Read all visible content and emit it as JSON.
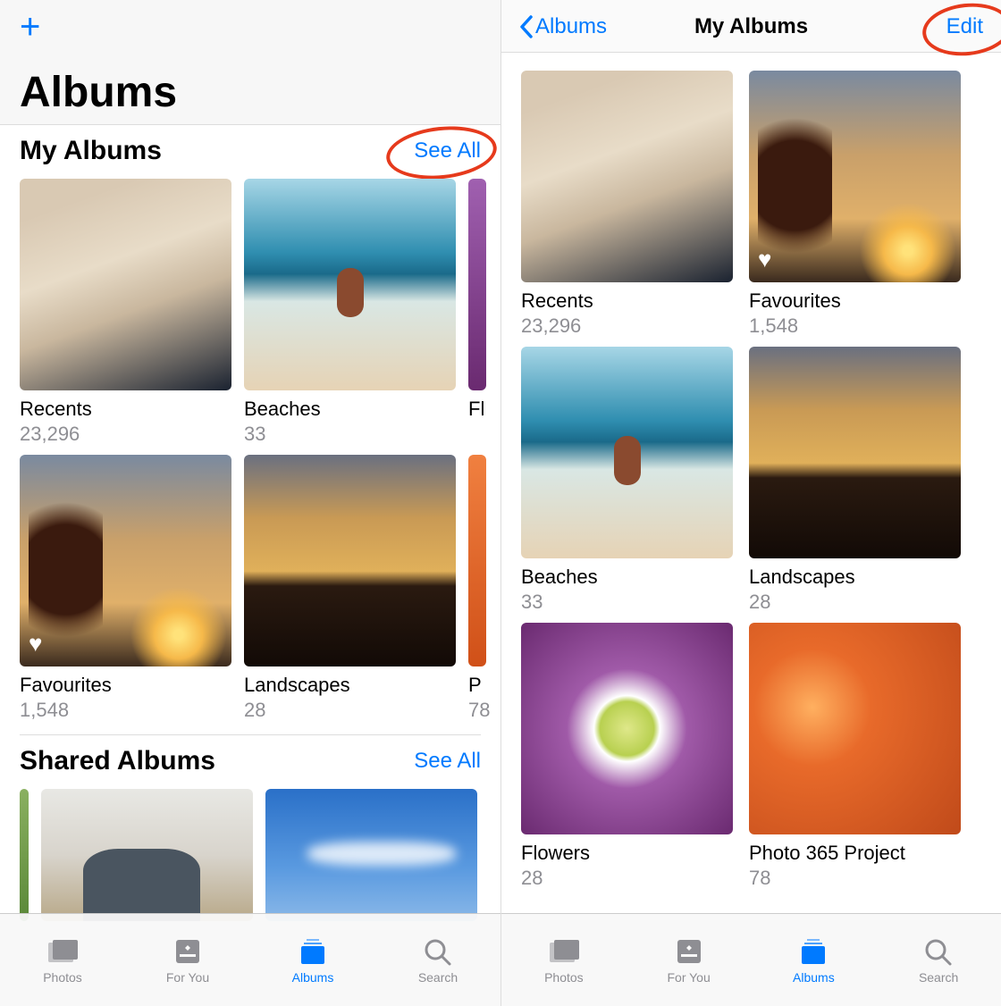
{
  "colors": {
    "accent": "#007aff",
    "annotation": "#e63a1c",
    "secondary": "#8e8e93"
  },
  "left": {
    "page_title": "Albums",
    "add_icon": "plus-icon",
    "my_albums": {
      "title": "My Albums",
      "see_all": "See All",
      "row1": [
        {
          "name": "Recents",
          "count": "23,296",
          "thumb": "portrait"
        },
        {
          "name": "Beaches",
          "count": "33",
          "thumb": "beach"
        },
        {
          "name": "Fl",
          "count": "",
          "thumb": "purple-sliver"
        }
      ],
      "row2": [
        {
          "name": "Favourites",
          "count": "1,548",
          "thumb": "sunset",
          "heart": true
        },
        {
          "name": "Landscapes",
          "count": "28",
          "thumb": "sea-sunset"
        },
        {
          "name": "P",
          "count": "78",
          "thumb": "orange-sliver"
        }
      ]
    },
    "shared": {
      "title": "Shared Albums",
      "see_all": "See All",
      "items": [
        {
          "thumb": "green-sliver"
        },
        {
          "thumb": "kids"
        },
        {
          "thumb": "sky"
        }
      ]
    }
  },
  "right": {
    "back_label": "Albums",
    "nav_title": "My Albums",
    "edit_label": "Edit",
    "albums": [
      {
        "name": "Recents",
        "count": "23,296",
        "thumb": "portrait"
      },
      {
        "name": "Favourites",
        "count": "1,548",
        "thumb": "sunset",
        "heart": true
      },
      {
        "name": "Beaches",
        "count": "33",
        "thumb": "beach"
      },
      {
        "name": "Landscapes",
        "count": "28",
        "thumb": "sea-sunset"
      },
      {
        "name": "Flowers",
        "count": "28",
        "thumb": "flower-purple"
      },
      {
        "name": "Photo 365 Project",
        "count": "78",
        "thumb": "flower-orange"
      }
    ]
  },
  "tabs": [
    {
      "label": "Photos",
      "icon": "photos-icon",
      "active": false
    },
    {
      "label": "For You",
      "icon": "foryou-icon",
      "active": false
    },
    {
      "label": "Albums",
      "icon": "albums-icon",
      "active": true
    },
    {
      "label": "Search",
      "icon": "search-icon",
      "active": false
    }
  ]
}
